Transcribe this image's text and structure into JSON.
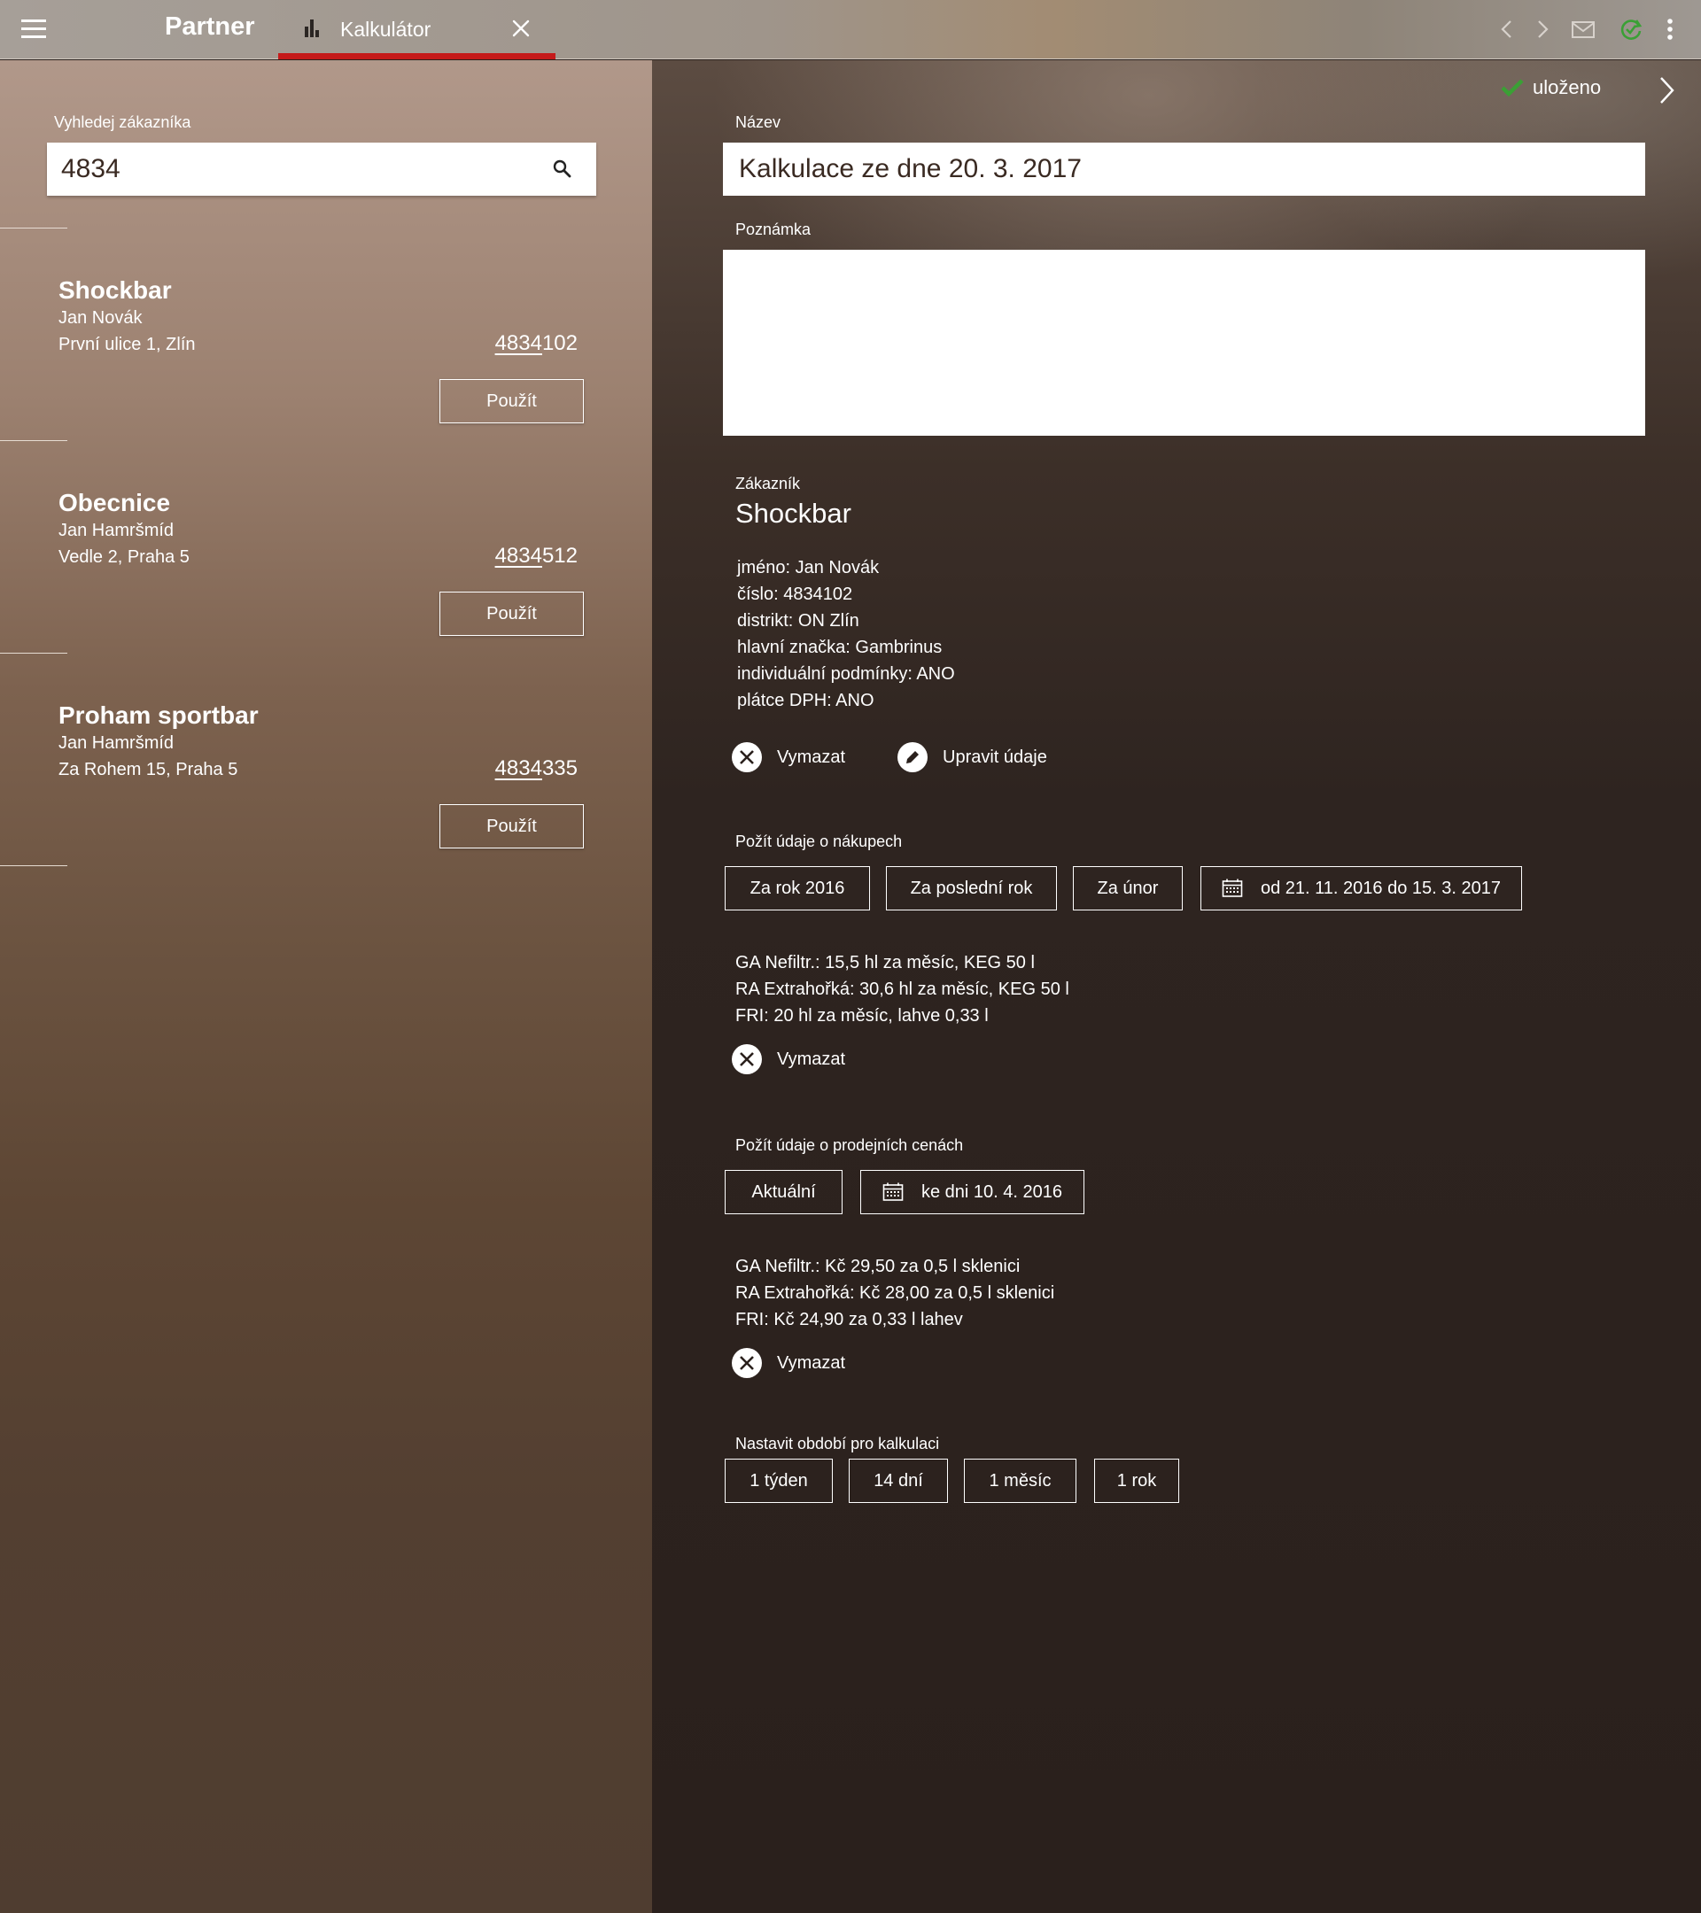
{
  "app": {
    "brand": "Partner"
  },
  "tab": {
    "label": "Kalkulátor"
  },
  "search": {
    "label": "Vyhledej zákazníka",
    "value": "4834"
  },
  "customers": [
    {
      "name": "Shockbar",
      "person": "Jan Novák",
      "address": "První ulice 1, Zlín",
      "number_match": "4834",
      "number_rest": "102",
      "use_label": "Použít"
    },
    {
      "name": "Obecnice",
      "person": "Jan Hamršmíd",
      "address": "Vedle 2, Praha 5",
      "number_match": "4834",
      "number_rest": "512",
      "use_label": "Použít"
    },
    {
      "name": "Proham sportbar",
      "person": "Jan Hamršmíd",
      "address": "Za Rohem 15, Praha 5",
      "number_match": "4834",
      "number_rest": "335",
      "use_label": "Použít"
    }
  ],
  "status": {
    "saved": "uloženo"
  },
  "form": {
    "name_label": "Název",
    "name_value": "Kalkulace ze dne 20. 3. 2017",
    "note_label": "Poznámka",
    "note_value": ""
  },
  "customer_detail": {
    "label": "Zákazník",
    "name": "Shockbar",
    "lines": [
      "jméno: Jan Novák",
      "číslo: 4834102",
      "distrikt: ON Zlín",
      "hlavní značka: Gambrinus",
      "individuální podmínky: ANO",
      "plátce DPH: ANO"
    ],
    "delete_label": "Vymazat",
    "edit_label": "Upravit údaje"
  },
  "purchases": {
    "label": "Požít údaje o nákupech",
    "buttons": [
      "Za rok 2016",
      "Za poslední rok",
      "Za únor"
    ],
    "range_label": "od 21. 11. 2016 do 15. 3. 2017",
    "lines": [
      "GA Nefiltr.: 15,5 hl za měsíc, KEG 50 l",
      "RA Extrahořká: 30,6 hl za měsíc, KEG 50 l",
      "FRI: 20 hl za měsíc, lahve 0,33 l"
    ],
    "delete_label": "Vymazat"
  },
  "prices": {
    "label": "Požít údaje o prodejních cenách",
    "current_label": "Aktuální",
    "date_label": "ke dni 10. 4. 2016",
    "lines": [
      "GA Nefiltr.: Kč 29,50 za 0,5 l sklenici",
      "RA Extrahořká: Kč 28,00 za 0,5 l sklenici",
      "FRI: Kč 24,90 za 0,33 l lahev"
    ],
    "delete_label": "Vymazat"
  },
  "period": {
    "label": "Nastavit období pro kalkulaci",
    "buttons": [
      "1 týden",
      "14 dní",
      "1 měsíc",
      "1 rok"
    ]
  },
  "colors": {
    "accent": "#c51a1a",
    "sync_ok": "#3aa035",
    "saved_check": "#3aa035"
  }
}
